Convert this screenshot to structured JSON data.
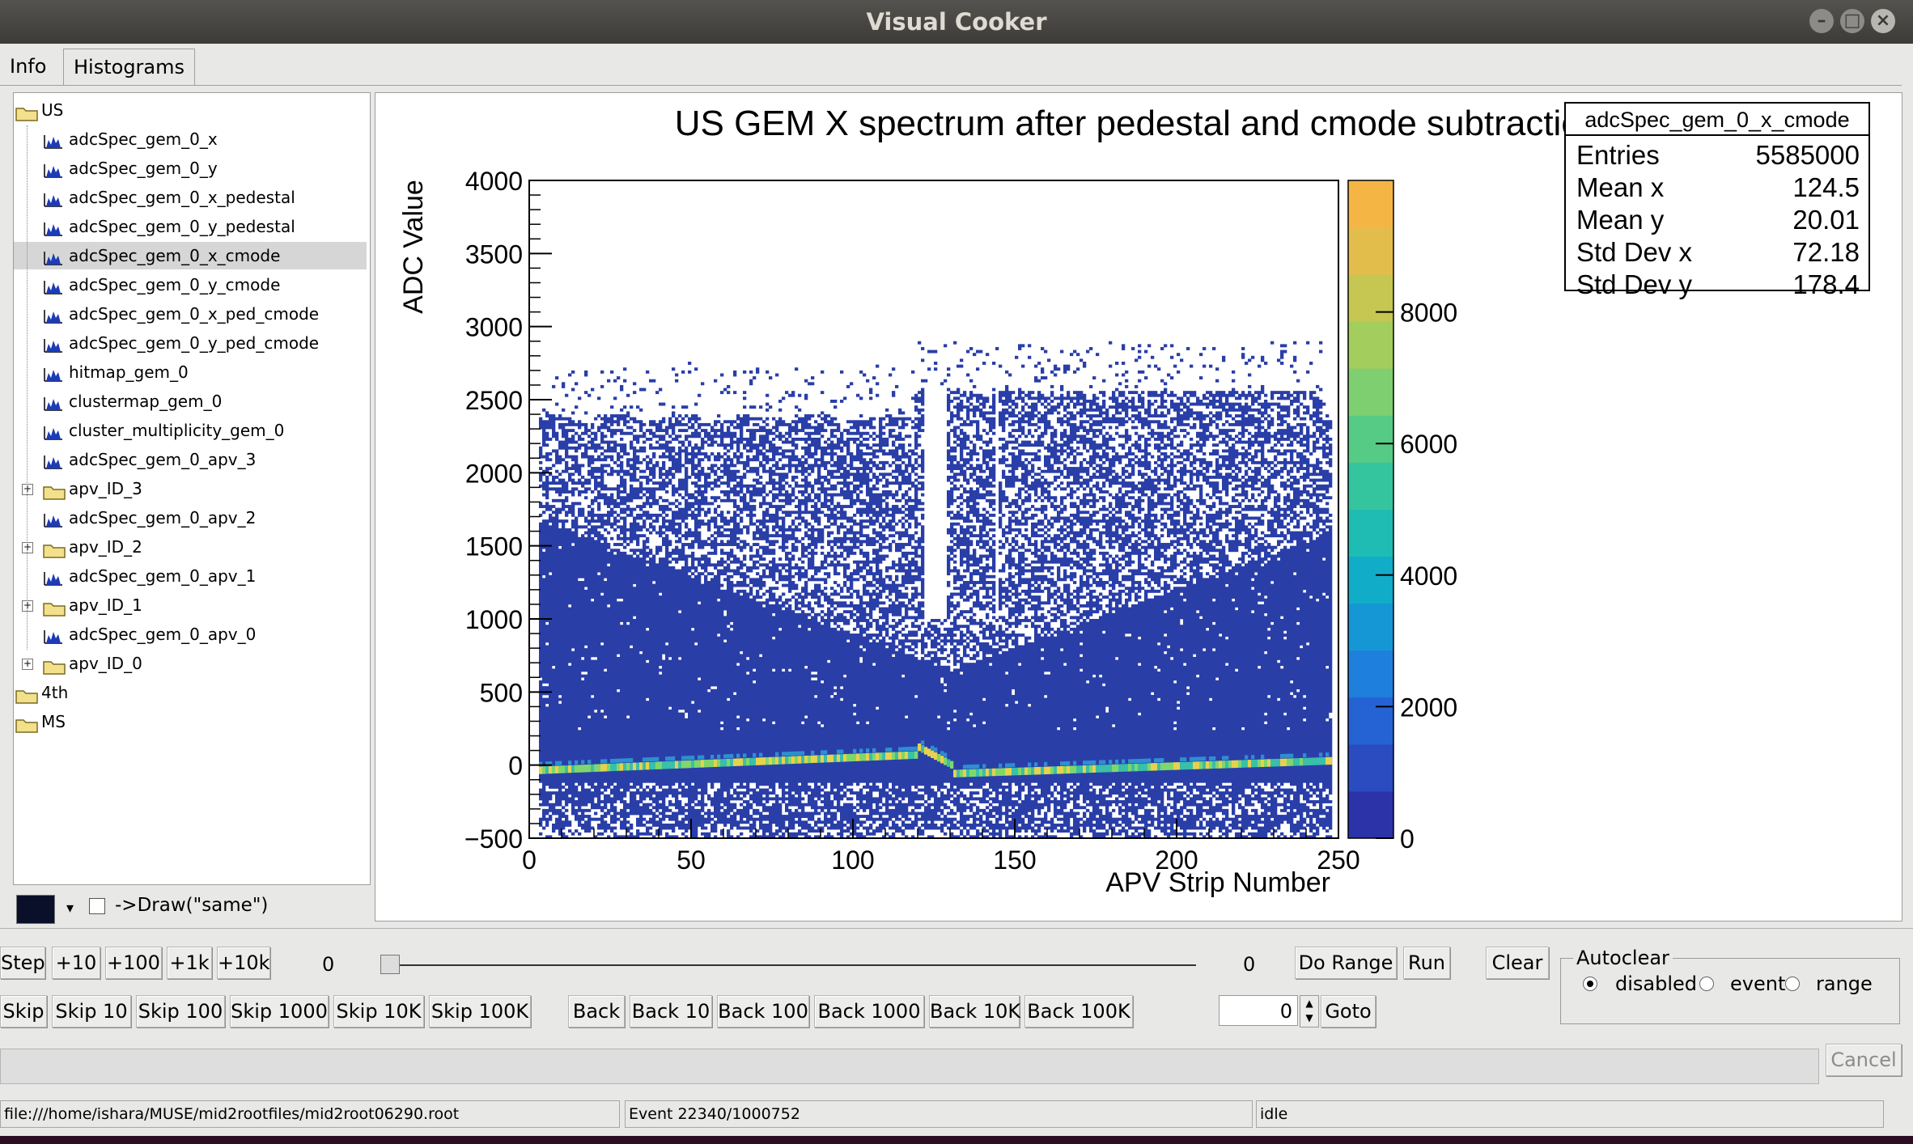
{
  "window": {
    "title": "Visual Cooker"
  },
  "tabs": [
    {
      "label": "Info"
    },
    {
      "label": "Histograms"
    }
  ],
  "tree": {
    "items": [
      {
        "label": "US",
        "type": "folder",
        "level": 0
      },
      {
        "label": "adcSpec_gem_0_x",
        "type": "hist",
        "level": 1
      },
      {
        "label": "adcSpec_gem_0_y",
        "type": "hist",
        "level": 1
      },
      {
        "label": "adcSpec_gem_0_x_pedestal",
        "type": "hist",
        "level": 1
      },
      {
        "label": "adcSpec_gem_0_y_pedestal",
        "type": "hist",
        "level": 1
      },
      {
        "label": "adcSpec_gem_0_x_cmode",
        "type": "hist",
        "level": 1,
        "selected": true
      },
      {
        "label": "adcSpec_gem_0_y_cmode",
        "type": "hist",
        "level": 1
      },
      {
        "label": "adcSpec_gem_0_x_ped_cmode",
        "type": "hist",
        "level": 1
      },
      {
        "label": "adcSpec_gem_0_y_ped_cmode",
        "type": "hist",
        "level": 1
      },
      {
        "label": "hitmap_gem_0",
        "type": "hist",
        "level": 1
      },
      {
        "label": "clustermap_gem_0",
        "type": "hist",
        "level": 1
      },
      {
        "label": "cluster_multiplicity_gem_0",
        "type": "hist",
        "level": 1
      },
      {
        "label": "adcSpec_gem_0_apv_3",
        "type": "hist",
        "level": 1
      },
      {
        "label": "apv_ID_3",
        "type": "folder",
        "level": 1
      },
      {
        "label": "adcSpec_gem_0_apv_2",
        "type": "hist",
        "level": 1
      },
      {
        "label": "apv_ID_2",
        "type": "folder",
        "level": 1
      },
      {
        "label": "adcSpec_gem_0_apv_1",
        "type": "hist",
        "level": 1
      },
      {
        "label": "apv_ID_1",
        "type": "folder",
        "level": 1
      },
      {
        "label": "adcSpec_gem_0_apv_0",
        "type": "hist",
        "level": 1
      },
      {
        "label": "apv_ID_0",
        "type": "folder",
        "level": 1
      },
      {
        "label": "4th",
        "type": "folder",
        "level": 0
      },
      {
        "label": "MS",
        "type": "folder",
        "level": 0
      }
    ],
    "draw_same_label": "->Draw(\"same\")"
  },
  "stats_box": {
    "name": "adcSpec_gem_0_x_cmode",
    "rows": [
      {
        "label": "Entries",
        "value": "5585000"
      },
      {
        "label": "Mean x",
        "value": "124.5"
      },
      {
        "label": "Mean y",
        "value": "20.01"
      },
      {
        "label": "Std Dev x",
        "value": "72.18"
      },
      {
        "label": "Std Dev y",
        "value": "178.4"
      }
    ]
  },
  "chart_data": {
    "type": "heatmap",
    "title": "US GEM X spectrum after pedestal and cmode subtraction",
    "xlabel": "APV Strip Number",
    "ylabel": "ADC Value",
    "xlim": [
      0,
      250
    ],
    "ylim": [
      -500,
      4000
    ],
    "x_ticks": [
      "0",
      "50",
      "100",
      "150",
      "200",
      "250"
    ],
    "y_ticks": [
      "−500",
      "0",
      "500",
      "1000",
      "1500",
      "2000",
      "2500",
      "3000",
      "3500",
      "4000"
    ],
    "z_ticks": [
      "0",
      "2000",
      "4000",
      "6000",
      "8000"
    ],
    "zlim": [
      0,
      10000
    ],
    "colors": {
      "background_bin": "#2a3ea8",
      "baseline": "#38c8a0"
    }
  },
  "controls": {
    "row1": {
      "step": "Step",
      "p10": "+10",
      "p100": "+100",
      "p1k": "+1k",
      "p10k": "+10k",
      "slider_min": "0",
      "slider_max": "0",
      "do_range": "Do Range",
      "run": "Run",
      "clear": "Clear"
    },
    "row2": {
      "skip": "Skip",
      "skip10": "Skip 10",
      "skip100": "Skip 100",
      "skip1000": "Skip 1000",
      "skip10k": "Skip 10K",
      "skip100k": "Skip 100K",
      "back": "Back",
      "back10": "Back 10",
      "back100": "Back 100",
      "back1000": "Back 1000",
      "back10k": "Back 10K",
      "back100k": "Back 100K",
      "goto_value": "0",
      "goto": "Goto"
    },
    "autoclear": {
      "title": "Autoclear",
      "options": [
        "disabled",
        "event",
        "range"
      ],
      "selected": "disabled"
    },
    "cancel": "Cancel"
  },
  "statusbar": {
    "file": "file:///home/ishara/MUSE/mid2rootfiles/mid2root06290.root",
    "event": "Event 22340/1000752",
    "state": "idle"
  }
}
